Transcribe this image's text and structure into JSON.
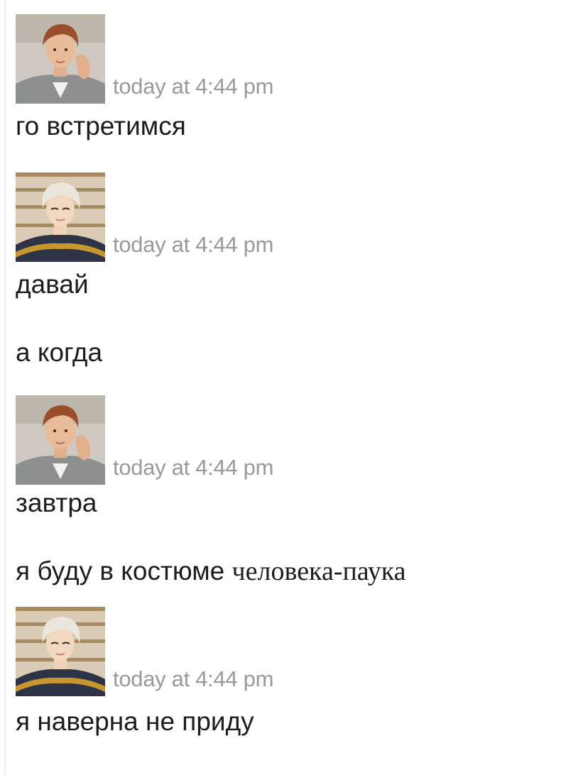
{
  "chat": {
    "messages": [
      {
        "sender": "boy",
        "timestamp": "today at 4:44 pm",
        "lines": [
          "го встретимся"
        ]
      },
      {
        "sender": "blonde",
        "timestamp": "today at 4:44 pm",
        "lines": [
          "давай",
          "а когда"
        ]
      },
      {
        "sender": "boy",
        "timestamp": "today at 4:44 pm",
        "lines": [
          "завтра"
        ],
        "mixed_line": {
          "sans": "я буду в костюме ",
          "serif": "человека-паука"
        }
      },
      {
        "sender": "blonde",
        "timestamp": "today at 4:44 pm",
        "lines": [
          "я наверна не приду"
        ]
      }
    ]
  },
  "colors": {
    "timestamp": "#9a9a9a",
    "text": "#1d1d1d",
    "background": "#ffffff"
  },
  "icons": {
    "boy_avatar": "avatar-brown-hair-icon",
    "blonde_avatar": "avatar-blonde-hair-icon"
  }
}
